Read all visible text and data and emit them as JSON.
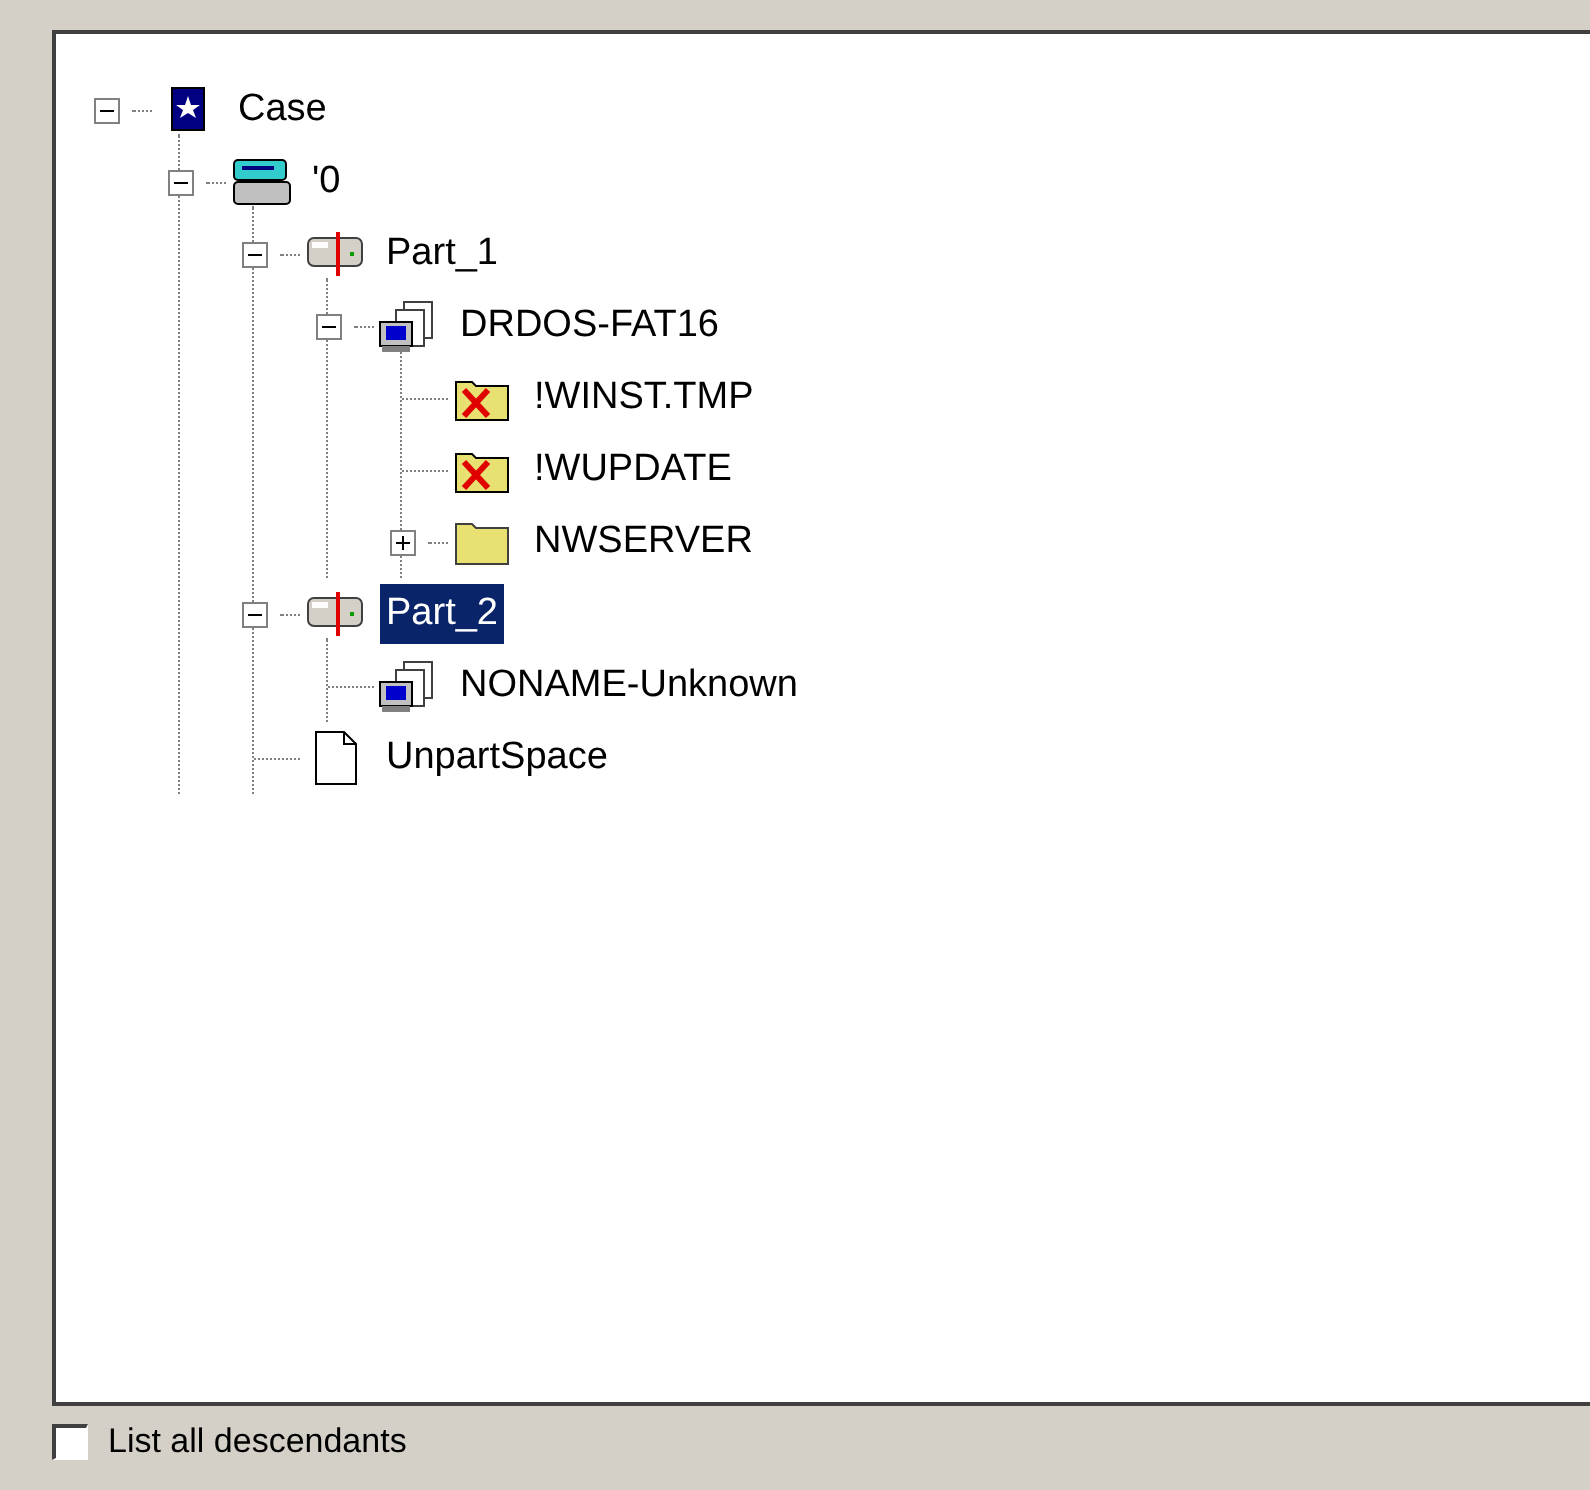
{
  "tree": [
    {
      "label": "Case",
      "kind": "case",
      "expanded": true,
      "selected": false,
      "children": [
        {
          "label": "'0",
          "kind": "disk",
          "expanded": true,
          "selected": false,
          "children": [
            {
              "label": "Part_1",
              "kind": "partition",
              "expanded": true,
              "selected": false,
              "children": [
                {
                  "label": "DRDOS-FAT16",
                  "kind": "volume",
                  "expanded": true,
                  "selected": false,
                  "children": [
                    {
                      "label": "!WINST.TMP",
                      "kind": "bad-folder",
                      "selected": false
                    },
                    {
                      "label": "!WUPDATE",
                      "kind": "bad-folder",
                      "selected": false
                    },
                    {
                      "label": "NWSERVER",
                      "kind": "folder",
                      "expanded": false,
                      "selected": false
                    }
                  ]
                }
              ]
            },
            {
              "label": "Part_2",
              "kind": "partition",
              "expanded": true,
              "selected": true,
              "children": [
                {
                  "label": "NONAME-Unknown",
                  "kind": "volume",
                  "selected": false
                }
              ]
            },
            {
              "label": "UnpartSpace",
              "kind": "file",
              "selected": false
            }
          ]
        }
      ]
    }
  ],
  "list_all_descendants": {
    "label": "List all descendants",
    "checked": false
  }
}
